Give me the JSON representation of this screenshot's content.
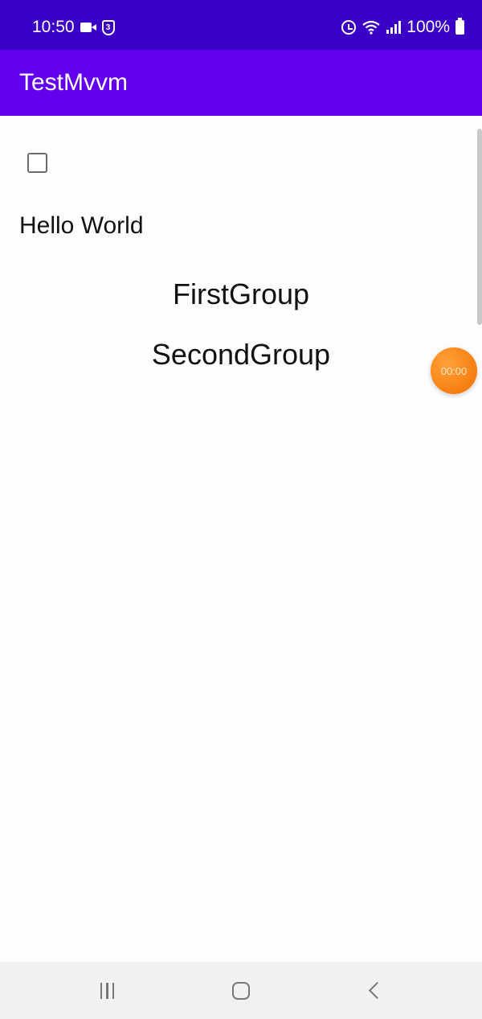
{
  "status_bar": {
    "time": "10:50",
    "shield_badge": "3",
    "battery_percent": "100%"
  },
  "app_bar": {
    "title": "TestMvvm"
  },
  "content": {
    "checkbox_checked": false,
    "hello_text": "Hello World",
    "first_group_label": "FirstGroup",
    "second_group_label": "SecondGroup",
    "timer_text": "00:00"
  },
  "nav_bar": {
    "icons": [
      "recents-icon",
      "home-icon",
      "back-icon"
    ]
  }
}
